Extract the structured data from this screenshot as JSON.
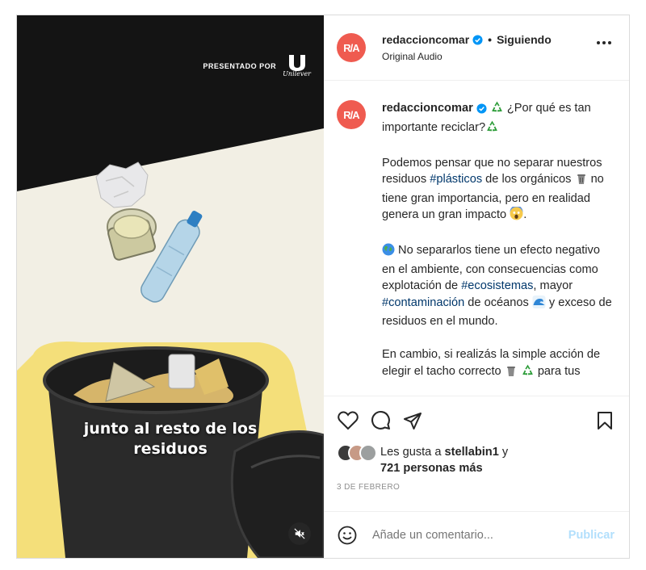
{
  "media": {
    "sponsor_label": "PRESENTADO POR",
    "sponsor_brand": "Unilever",
    "caption_overlay_line1": "junto al resto de los",
    "caption_overlay_line2": "residuos",
    "mute_icon": "speaker-muted-icon"
  },
  "header": {
    "avatar_text": "R/A",
    "username": "redaccioncomar",
    "separator": "•",
    "follow_status": "Siguiendo",
    "audio_label": "Original Audio"
  },
  "caption": {
    "username": "redaccioncomar",
    "p1_text": "¿Por qué es tan importante reciclar?",
    "p2_pre": "Podemos pensar que no separar nuestros residuos ",
    "p2_tag": "#plásticos",
    "p2_mid": " de los orgánicos ",
    "p2_post": " no tiene gran importancia, pero en realidad genera un gran impacto ",
    "p2_end": ".",
    "p3_pre": " No separarlos tiene un efecto negativo en el ambiente, con consecuencias como explotación de ",
    "p3_tag1": "#ecosistemas",
    "p3_mid": ", mayor ",
    "p3_tag2": "#contaminación",
    "p3_mid2": " de océanos ",
    "p3_post": " y exceso de residuos en el mundo.",
    "p4_pre": "En cambio, si realizás la simple acción de elegir el tacho correcto ",
    "p4_post": " para tus"
  },
  "likes": {
    "prefix": "Les gusta a ",
    "user": "stellabin1",
    "suffix": " y",
    "others": "721 personas más"
  },
  "date": "3 DE FEBRERO",
  "comment": {
    "placeholder": "Añade un comentario...",
    "post_label": "Publicar"
  },
  "colors": {
    "accent_avatar": "#ef5b50",
    "verified": "#0095f6",
    "hashtag": "#00376b",
    "post_disabled": "#b2dffc"
  }
}
